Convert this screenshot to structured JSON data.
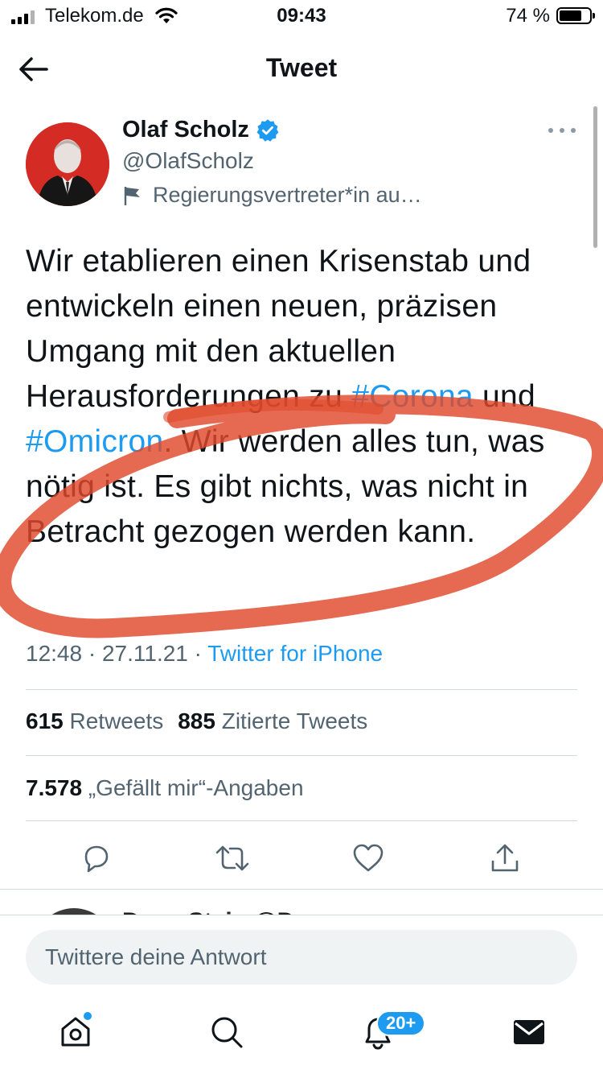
{
  "status_bar": {
    "carrier": "Telekom.de",
    "time": "09:43",
    "battery_percent": "74 %",
    "battery_level": 0.74
  },
  "header": {
    "title": "Tweet",
    "back_icon": "arrow-left-icon"
  },
  "author": {
    "name": "Olaf Scholz",
    "handle": "@OlafScholz",
    "label": "Regierungsvertreter*in au…",
    "verified": true
  },
  "tweet": {
    "text_part1": "Wir etablieren einen Krisenstab und entwickeln einen neuen, präzisen Umgang mit den aktuellen Herausforderungen zu ",
    "hashtag1": "#Corona",
    "text_part2": " und ",
    "hashtag2": "#Omicron",
    "text_part3": ". Wir werden alles tun, was nötig ist. Es gibt nichts, was nicht in Betracht gezogen werden kann.",
    "timestamp": "12:48 · 27.11.21 · ",
    "source": "Twitter for iPhone"
  },
  "stats": {
    "retweets_count": "615",
    "retweets_label": "Retweets",
    "quotes_count": "885",
    "quotes_label": "Zitierte Tweets",
    "likes_count": "7.578",
    "likes_label": "„Gefällt mir“-Angaben"
  },
  "actions": [
    "reply-icon",
    "retweet-icon",
    "like-icon",
    "share-icon"
  ],
  "reply_peek": {
    "text": "Dr. ... Stein @Dr. ..."
  },
  "reply_box": {
    "placeholder": "Twittere deine Antwort"
  },
  "tabbar": {
    "notifications_badge": "20+"
  },
  "colors": {
    "accent": "#1d9bf0",
    "marker": "#e0492c",
    "secondary_text": "#536471"
  }
}
